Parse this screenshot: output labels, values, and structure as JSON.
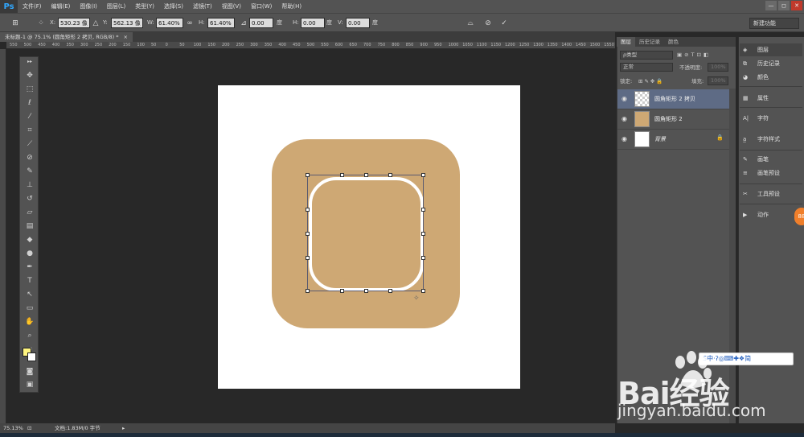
{
  "app": {
    "logo": "Ps"
  },
  "menu": [
    "文件(F)",
    "编辑(E)",
    "图像(I)",
    "图层(L)",
    "类型(Y)",
    "选择(S)",
    "滤镜(T)",
    "视图(V)",
    "窗口(W)",
    "帮助(H)"
  ],
  "window_controls": {
    "minimize": "—",
    "maximize": "◻",
    "close": "✕"
  },
  "options_bar": {
    "x_label": "X:",
    "x_value": "530.23 像",
    "y_label": "Y:",
    "y_value": "562.13 像",
    "w_label": "W:",
    "w_value": "61.40%",
    "h_label": "H:",
    "h_value": "61.40%",
    "angle_value": "0.00",
    "angle_unit": "度",
    "hskew_label": "H:",
    "hskew_value": "0.00",
    "hskew_unit": "度",
    "vskew_label": "V:",
    "vskew_value": "0.00",
    "vskew_unit": "度",
    "workspace": "新建功能"
  },
  "document": {
    "tab_title": "未标题-1 @ 75.1% (圆角矩形 2 拷贝, RGB/8) *",
    "close": "×"
  },
  "rulers": {
    "top_ticks": [
      "550",
      "500",
      "450",
      "400",
      "350",
      "300",
      "250",
      "200",
      "150",
      "100",
      "50",
      "0",
      "50",
      "100",
      "150",
      "200",
      "250",
      "300",
      "350",
      "400",
      "450",
      "500",
      "550",
      "600",
      "650",
      "700",
      "750",
      "800",
      "850",
      "900",
      "950",
      "1000",
      "1050",
      "1100",
      "1150",
      "1200",
      "1250",
      "1300",
      "1350",
      "1400",
      "1450",
      "1500",
      "1550"
    ]
  },
  "status_bar": {
    "zoom": "75.13%",
    "doc_info": "文档:1.83M/0 字节"
  },
  "layers_panel": {
    "tabs": [
      "图层",
      "历史记录",
      "颜色"
    ],
    "filter_label": "ρ类型",
    "blend_mode": "正常",
    "opacity_label": "不透明度:",
    "opacity_value": "100%",
    "lock_label": "锁定:",
    "fill_label": "填充:",
    "fill_value": "100%",
    "layers": [
      {
        "name": "圆角矩形 2 拷贝",
        "selected": true
      },
      {
        "name": "圆角矩形 2",
        "selected": false
      },
      {
        "name": "背景",
        "selected": false
      }
    ]
  },
  "dock": {
    "items": [
      "图层",
      "历史记录",
      "颜色",
      "属性",
      "字符",
      "字符样式",
      "画笔",
      "画笔预设",
      "工具预设",
      "动作"
    ]
  },
  "watermark": {
    "badge": "S中·ʔ◎⌨✚❖简",
    "logo": "Bai经验",
    "url": "jingyan.baidu.com"
  },
  "colors": {
    "canvas_bg": "#282828",
    "tan_square": "#cea874",
    "foreground": "#fff580",
    "background": "#ffffff",
    "selected_layer": "#5e6b85"
  }
}
